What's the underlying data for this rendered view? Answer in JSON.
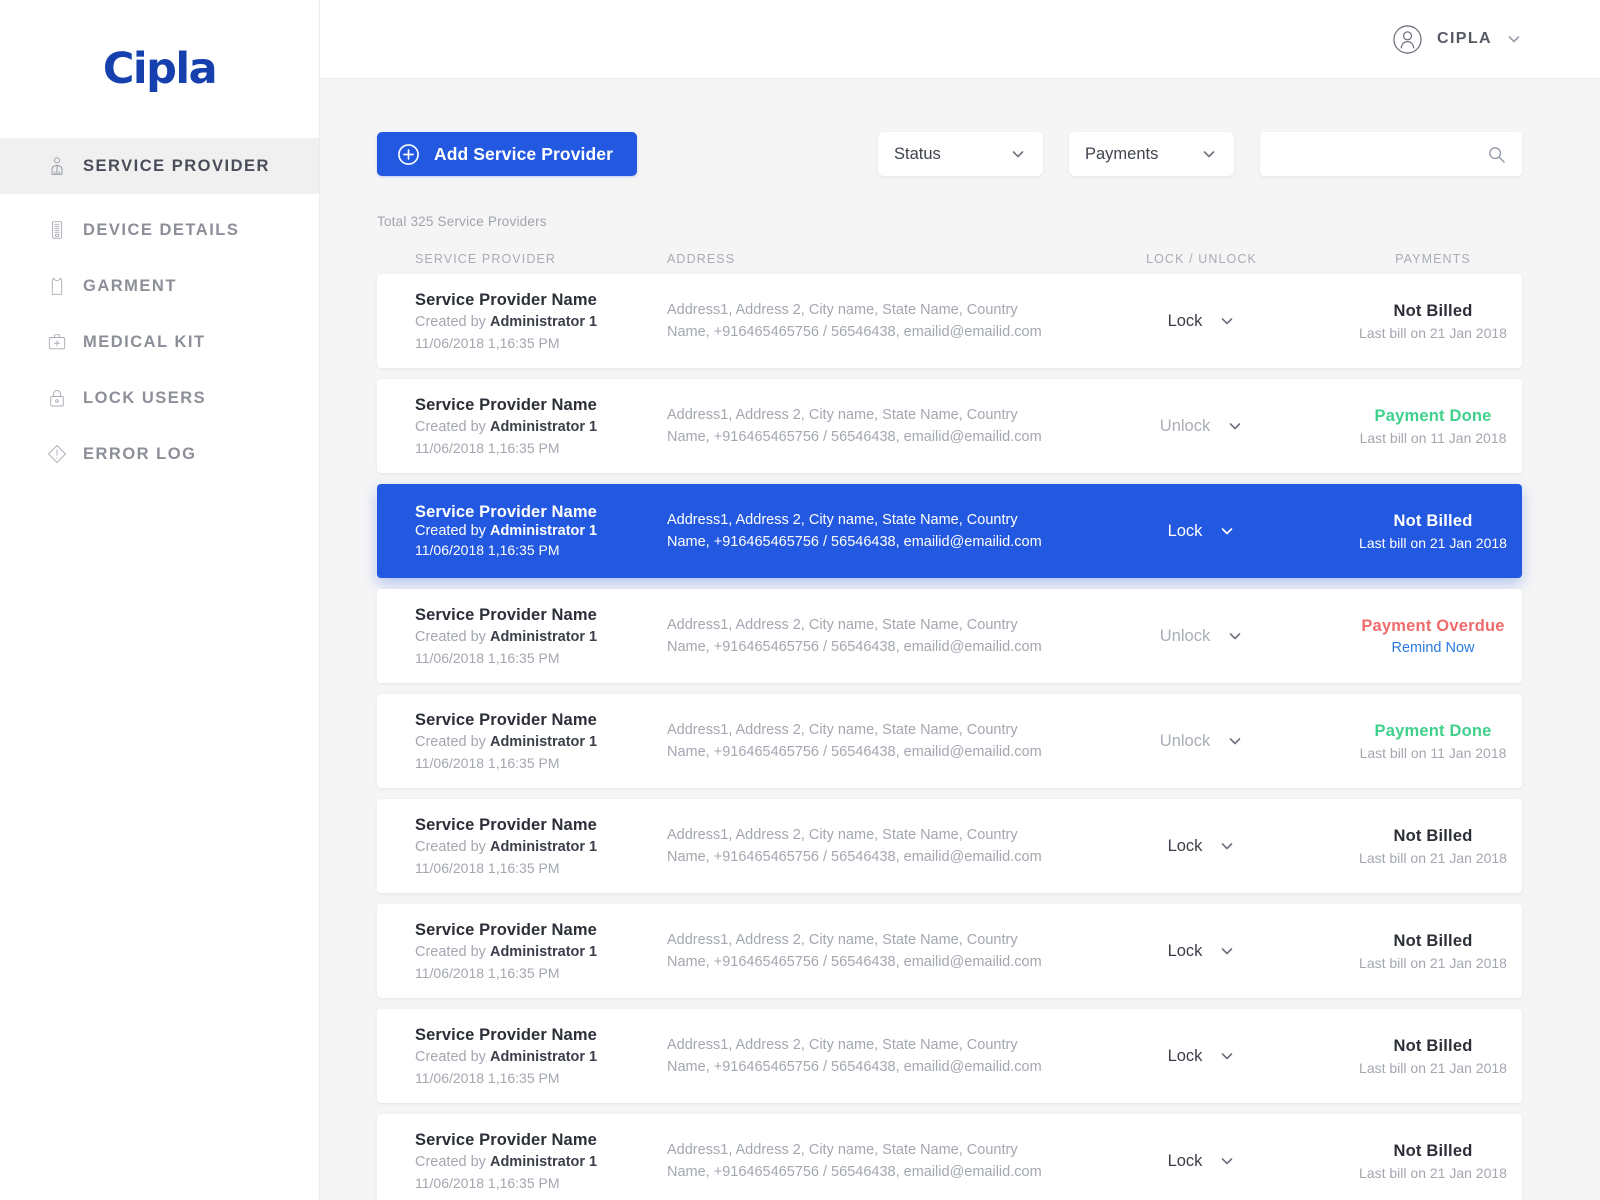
{
  "brand": {
    "logo_text": "Cipla",
    "logo_color": "#1540ad"
  },
  "colors": {
    "accent_blue": "#2358e0",
    "payment_done_green": "#3fd18c",
    "payment_overdue_red": "#ef6b6b",
    "link_blue": "#2c7be5",
    "page_background": "#f5f5f6"
  },
  "sidebar": {
    "items": [
      {
        "label": "SERVICE PROVIDER",
        "icon": "service-provider-icon",
        "active": true
      },
      {
        "label": "DEVICE DETAILS",
        "icon": "device-icon",
        "active": false
      },
      {
        "label": "GARMENT",
        "icon": "garment-icon",
        "active": false
      },
      {
        "label": "MEDICAL KIT",
        "icon": "medical-kit-icon",
        "active": false
      },
      {
        "label": "LOCK USERS",
        "icon": "lock-icon",
        "active": false
      },
      {
        "label": "ERROR LOG",
        "icon": "error-log-icon",
        "active": false
      }
    ]
  },
  "topbar": {
    "user_name": "CIPLA",
    "avatar_icon": "user-avatar-icon",
    "caret_icon": "chevron-down-icon"
  },
  "toolbar": {
    "add_button_label": "Add Service Provider",
    "add_button_icon": "plus-circle-icon",
    "status_filter": {
      "label": "Status",
      "caret_icon": "chevron-down-icon"
    },
    "payments_filter": {
      "label": "Payments",
      "caret_icon": "chevron-down-icon"
    },
    "search": {
      "value": "",
      "placeholder": "",
      "icon": "search-icon"
    }
  },
  "summary": {
    "total_text": "Total 325 Service Providers"
  },
  "table": {
    "headers": {
      "provider": "SERVICE PROVIDER",
      "address": "ADDRESS",
      "lock": "LOCK / UNLOCK",
      "payments": "PAYMENTS"
    },
    "rows": [
      {
        "name": "Service Provider Name",
        "created_prefix": "Created by ",
        "created_by": "Administrator 1",
        "date": "11/06/2018 1,16:35 PM",
        "address": "Address1, Address 2, City name, State Name, Country Name, +916465465756 / 56546438, emailid@emailid.com",
        "lock_label": "Lock",
        "lock_muted": false,
        "payment_status": "Not Billed",
        "payment_state": "notbilled",
        "payment_sub": "Last bill on 21 Jan 2018",
        "payment_link": "",
        "selected": false
      },
      {
        "name": "Service Provider Name",
        "created_prefix": "Created by ",
        "created_by": "Administrator 1",
        "date": "11/06/2018 1,16:35 PM",
        "address": "Address1, Address 2, City name, State Name, Country Name, +916465465756 / 56546438, emailid@emailid.com",
        "lock_label": "Unlock",
        "lock_muted": true,
        "payment_status": "Payment Done",
        "payment_state": "done",
        "payment_sub": "Last bill on 11 Jan 2018",
        "payment_link": "",
        "selected": false
      },
      {
        "name": "Service Provider Name",
        "created_prefix": "Created by ",
        "created_by": "Administrator 1",
        "date": "11/06/2018 1,16:35 PM",
        "address": "Address1, Address 2, City name, State Name, Country Name, +916465465756 / 56546438, emailid@emailid.com",
        "lock_label": "Lock",
        "lock_muted": false,
        "payment_status": "Not Billed",
        "payment_state": "notbilled",
        "payment_sub": "Last bill on 21 Jan 2018",
        "payment_link": "",
        "selected": true
      },
      {
        "name": "Service Provider Name",
        "created_prefix": "Created by ",
        "created_by": "Administrator 1",
        "date": "11/06/2018 1,16:35 PM",
        "address": "Address1, Address 2, City name, State Name, Country Name, +916465465756 / 56546438, emailid@emailid.com",
        "lock_label": "Unlock",
        "lock_muted": true,
        "payment_status": "Payment Overdue",
        "payment_state": "overdue",
        "payment_sub": "",
        "payment_link": "Remind Now",
        "selected": false
      },
      {
        "name": "Service Provider Name",
        "created_prefix": "Created by ",
        "created_by": "Administrator 1",
        "date": "11/06/2018 1,16:35 PM",
        "address": "Address1, Address 2, City name, State Name, Country Name, +916465465756 / 56546438, emailid@emailid.com",
        "lock_label": "Unlock",
        "lock_muted": true,
        "payment_status": "Payment Done",
        "payment_state": "done",
        "payment_sub": "Last bill on 11 Jan 2018",
        "payment_link": "",
        "selected": false
      },
      {
        "name": "Service Provider Name",
        "created_prefix": "Created by ",
        "created_by": "Administrator 1",
        "date": "11/06/2018 1,16:35 PM",
        "address": "Address1, Address 2, City name, State Name, Country Name, +916465465756 / 56546438, emailid@emailid.com",
        "lock_label": "Lock",
        "lock_muted": false,
        "payment_status": "Not Billed",
        "payment_state": "notbilled",
        "payment_sub": "Last bill on 21 Jan 2018",
        "payment_link": "",
        "selected": false
      },
      {
        "name": "Service Provider Name",
        "created_prefix": "Created by ",
        "created_by": "Administrator 1",
        "date": "11/06/2018 1,16:35 PM",
        "address": "Address1, Address 2, City name, State Name, Country Name, +916465465756 / 56546438, emailid@emailid.com",
        "lock_label": "Lock",
        "lock_muted": false,
        "payment_status": "Not Billed",
        "payment_state": "notbilled",
        "payment_sub": "Last bill on 21 Jan 2018",
        "payment_link": "",
        "selected": false
      },
      {
        "name": "Service Provider Name",
        "created_prefix": "Created by ",
        "created_by": "Administrator 1",
        "date": "11/06/2018 1,16:35 PM",
        "address": "Address1, Address 2, City name, State Name, Country Name, +916465465756 / 56546438, emailid@emailid.com",
        "lock_label": "Lock",
        "lock_muted": false,
        "payment_status": "Not Billed",
        "payment_state": "notbilled",
        "payment_sub": "Last bill on 21 Jan 2018",
        "payment_link": "",
        "selected": false
      },
      {
        "name": "Service Provider Name",
        "created_prefix": "Created by ",
        "created_by": "Administrator 1",
        "date": "11/06/2018 1,16:35 PM",
        "address": "Address1, Address 2, City name, State Name, Country Name, +916465465756 / 56546438, emailid@emailid.com",
        "lock_label": "Lock",
        "lock_muted": false,
        "payment_status": "Not Billed",
        "payment_state": "notbilled",
        "payment_sub": "Last bill on 21 Jan 2018",
        "payment_link": "",
        "selected": false
      }
    ]
  }
}
